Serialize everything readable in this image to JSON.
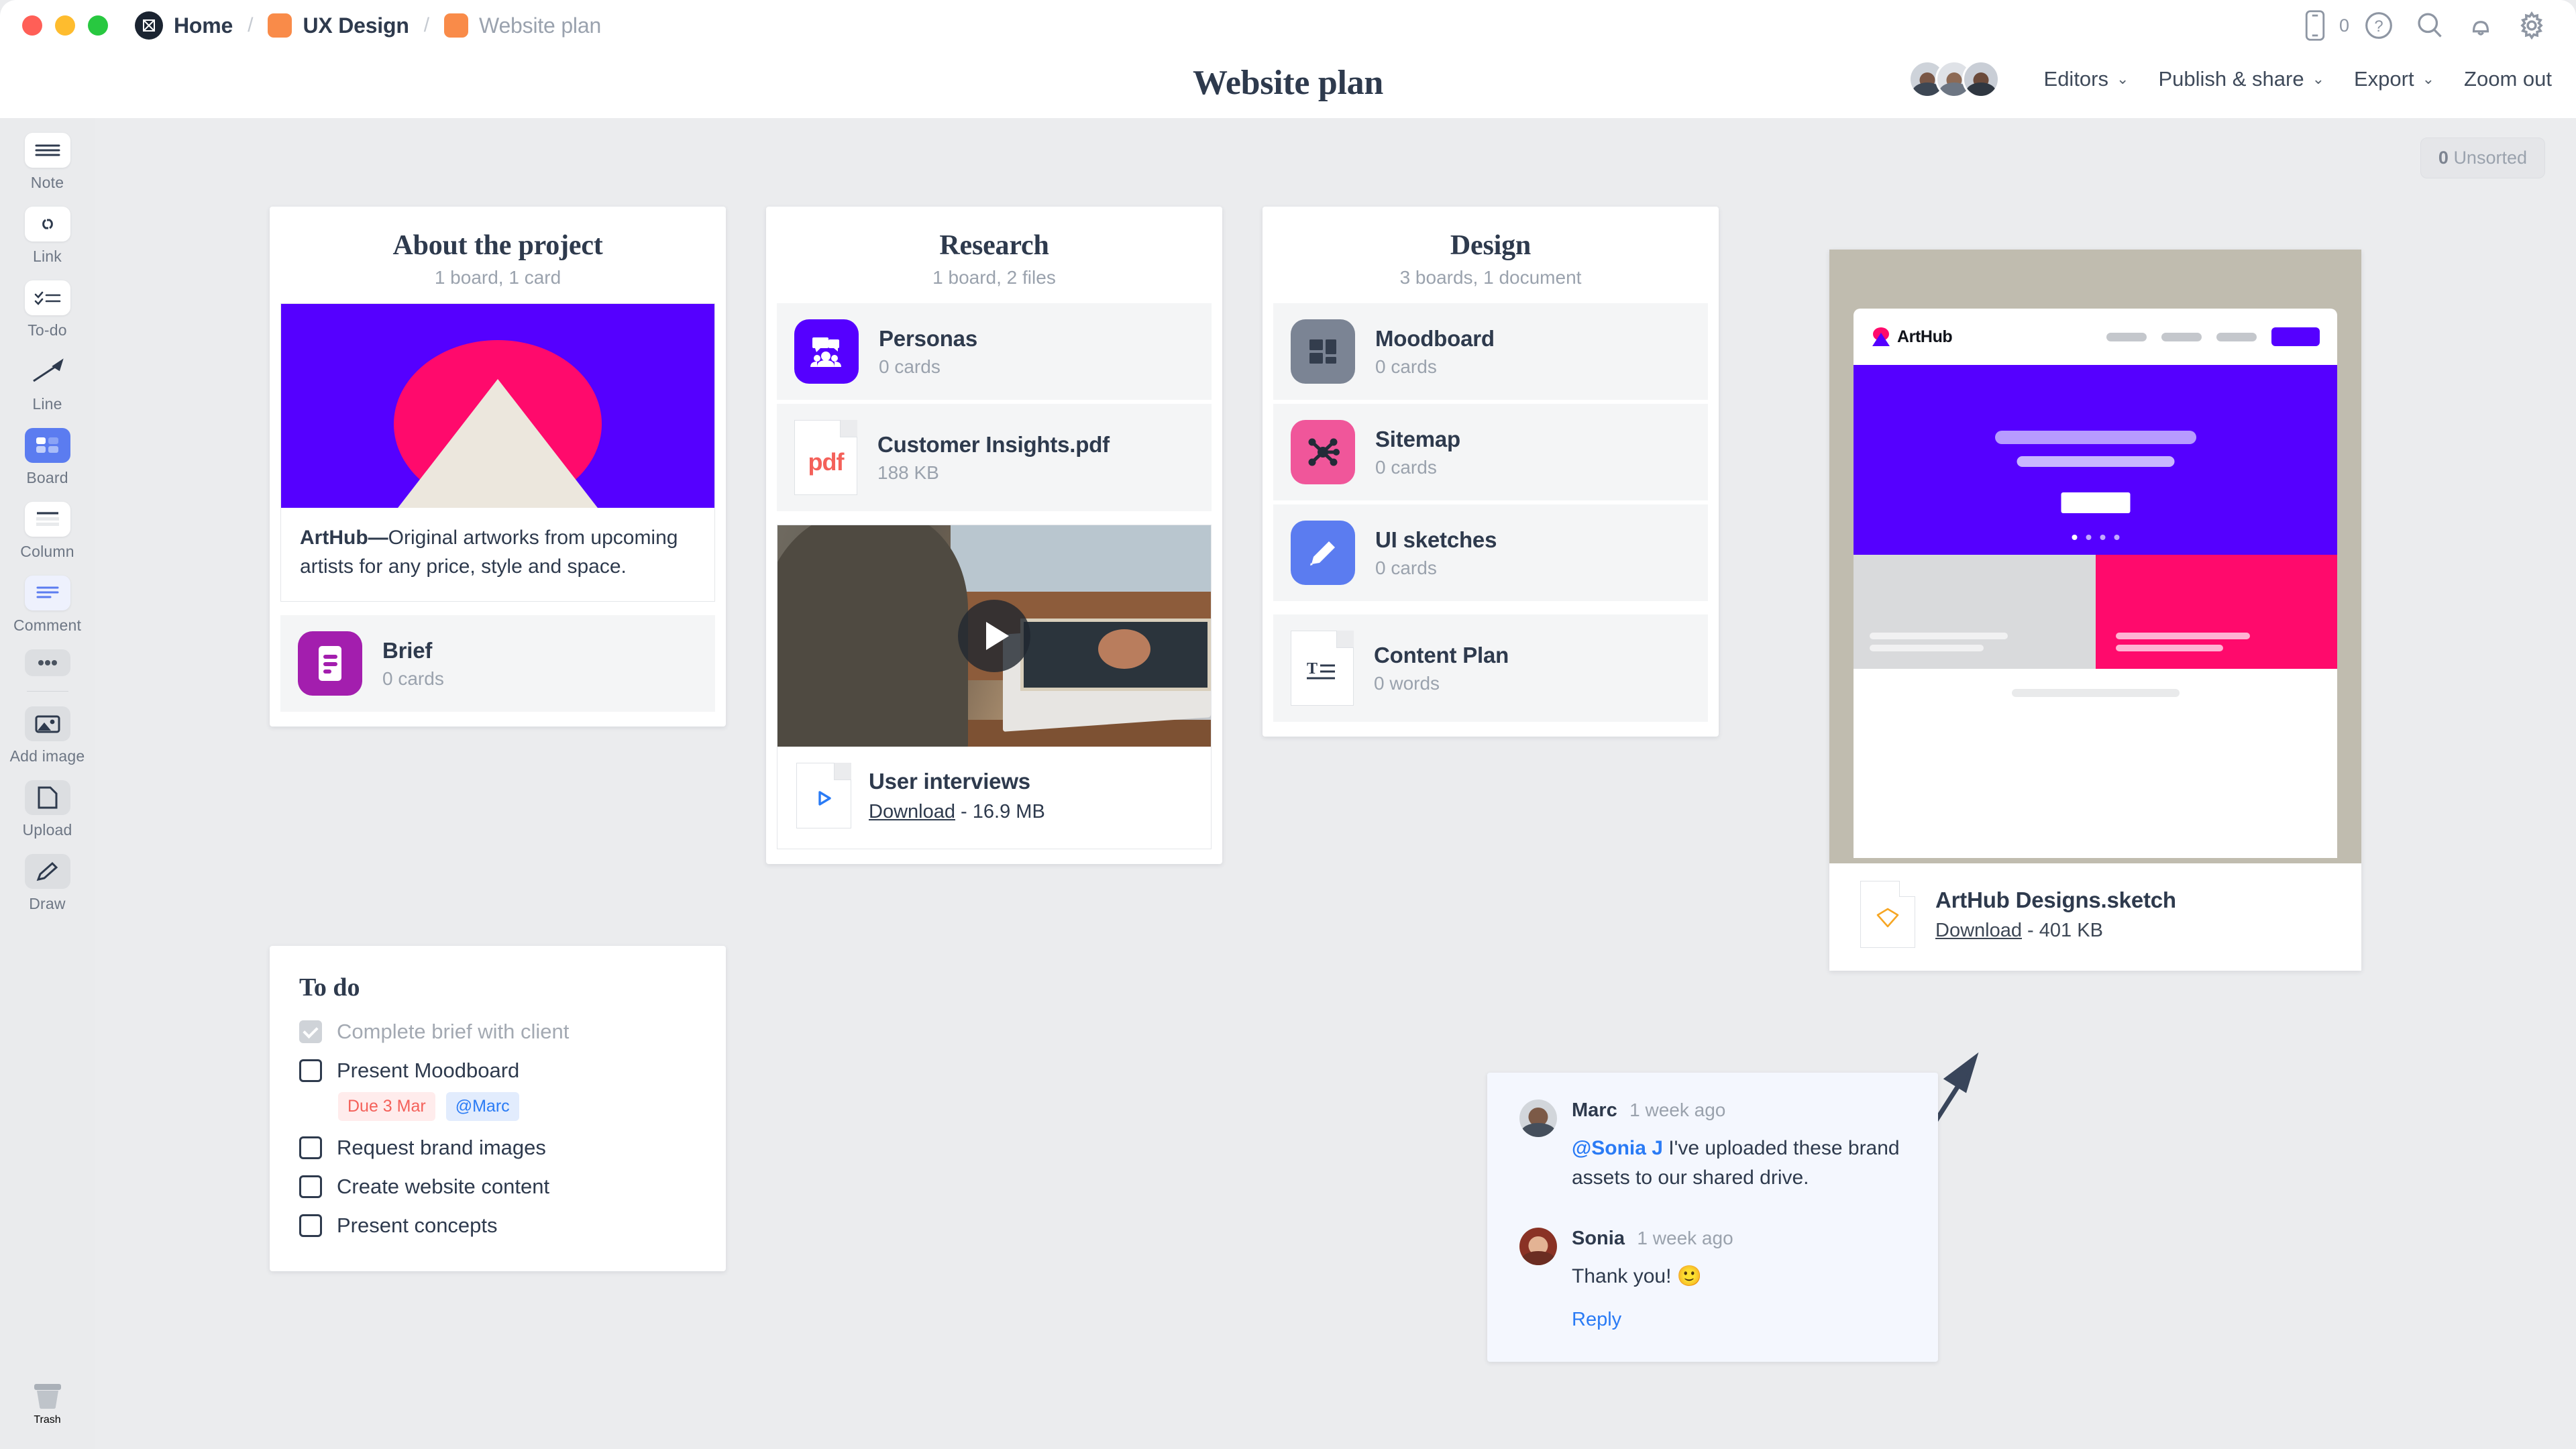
{
  "window": {
    "traffic_lights": [
      "close",
      "minimize",
      "maximize"
    ]
  },
  "breadcrumb": {
    "home_label": "Home",
    "separator": "/",
    "items": [
      {
        "label": "UX Design",
        "color": "#f98b49"
      },
      {
        "label": "Website plan",
        "color": "#f98b49"
      }
    ]
  },
  "top_right_icons": [
    {
      "name": "mobile-icon",
      "count": "0"
    },
    {
      "name": "help-icon"
    },
    {
      "name": "search-icon"
    },
    {
      "name": "notifications-icon"
    },
    {
      "name": "settings-icon"
    }
  ],
  "header": {
    "title": "Website plan",
    "editors_label": "Editors",
    "publish_label": "Publish & share",
    "export_label": "Export",
    "zoom_label": "Zoom out",
    "chevron": "⌄"
  },
  "toolbar": {
    "items": [
      {
        "label": "Note",
        "icon": "note-icon",
        "active": false
      },
      {
        "label": "Link",
        "icon": "link-icon",
        "active": false
      },
      {
        "label": "To-do",
        "icon": "todo-icon",
        "active": false
      },
      {
        "label": "Line",
        "icon": "line-icon",
        "active": false
      },
      {
        "label": "Board",
        "icon": "board-icon",
        "active": true
      },
      {
        "label": "Column",
        "icon": "column-icon",
        "active": false
      },
      {
        "label": "Comment",
        "icon": "comment-icon",
        "active": false
      },
      {
        "label": "",
        "icon": "more-icon",
        "active": false
      },
      {
        "label": "Add image",
        "icon": "add-image-icon",
        "active": false
      },
      {
        "label": "Upload",
        "icon": "upload-icon",
        "active": false
      },
      {
        "label": "Draw",
        "icon": "draw-icon",
        "active": false
      }
    ],
    "trash_label": "Trash"
  },
  "canvas": {
    "unsorted_count": "0",
    "unsorted_label": "Unsorted"
  },
  "columns": [
    {
      "title": "About the project",
      "subtitle": "1 board, 1 card",
      "note": {
        "text_bold": "ArtHub—",
        "text_rest": "Original artworks from upcoming artists for any price, style and space."
      },
      "items": [
        {
          "name": "Brief",
          "meta": "0 cards",
          "icon": "brief-icon",
          "color": "#a31eae"
        }
      ]
    },
    {
      "title": "Research",
      "subtitle": "1 board, 2 files",
      "items": [
        {
          "name": "Personas",
          "meta": "0 cards",
          "icon": "personas-icon",
          "color": "#5500ff"
        },
        {
          "name": "Customer Insights.pdf",
          "meta": "188 KB",
          "icon": "pdf-file-icon",
          "badge": "pdf"
        }
      ],
      "video": {
        "name": "User interviews",
        "download_label": "Download",
        "size": "16.9 MB",
        "separator": "-"
      }
    },
    {
      "title": "Design",
      "subtitle": "3 boards, 1 document",
      "items": [
        {
          "name": "Moodboard",
          "meta": "0 cards",
          "icon": "moodboard-icon",
          "color": "#7b8494"
        },
        {
          "name": "Sitemap",
          "meta": "0 cards",
          "icon": "sitemap-icon",
          "color": "#f0569a"
        },
        {
          "name": "UI sketches",
          "meta": "0 cards",
          "icon": "ui-sketches-icon",
          "color": "#5b7cf0"
        },
        {
          "name": "Content Plan",
          "meta": "0 words",
          "icon": "document-icon"
        }
      ]
    }
  ],
  "sketch_preview": {
    "brand": "ArtHub",
    "file_name": "ArtHub Designs.sketch",
    "download_label": "Download",
    "separator": "-",
    "size": "401 KB",
    "colors": {
      "hero": "#5500ff",
      "accent": "#ff0a6c",
      "backdrop": "#c0bcaf"
    }
  },
  "todo": {
    "title": "To do",
    "items": [
      {
        "label": "Complete brief with client",
        "done": true
      },
      {
        "label": "Present Moodboard",
        "done": false,
        "due": "Due 3 Mar",
        "mention": "@Marc"
      },
      {
        "label": "Request brand images",
        "done": false
      },
      {
        "label": "Create website content",
        "done": false
      },
      {
        "label": "Present concepts",
        "done": false
      }
    ]
  },
  "comments": {
    "reply_label": "Reply",
    "entries": [
      {
        "author": "Marc",
        "time": "1 week ago",
        "mention": "@Sonia J",
        "text": " I've uploaded these brand assets to our shared drive."
      },
      {
        "author": "Sonia",
        "time": "1 week ago",
        "mention": "",
        "text": "Thank you! 🙂"
      }
    ]
  },
  "colors": {
    "accent_blue": "#2a7bf5",
    "text_dark": "#2e3a4d",
    "text_muted": "#9aa2ad",
    "canvas_bg": "#ebecee",
    "danger": "#f4615a"
  }
}
